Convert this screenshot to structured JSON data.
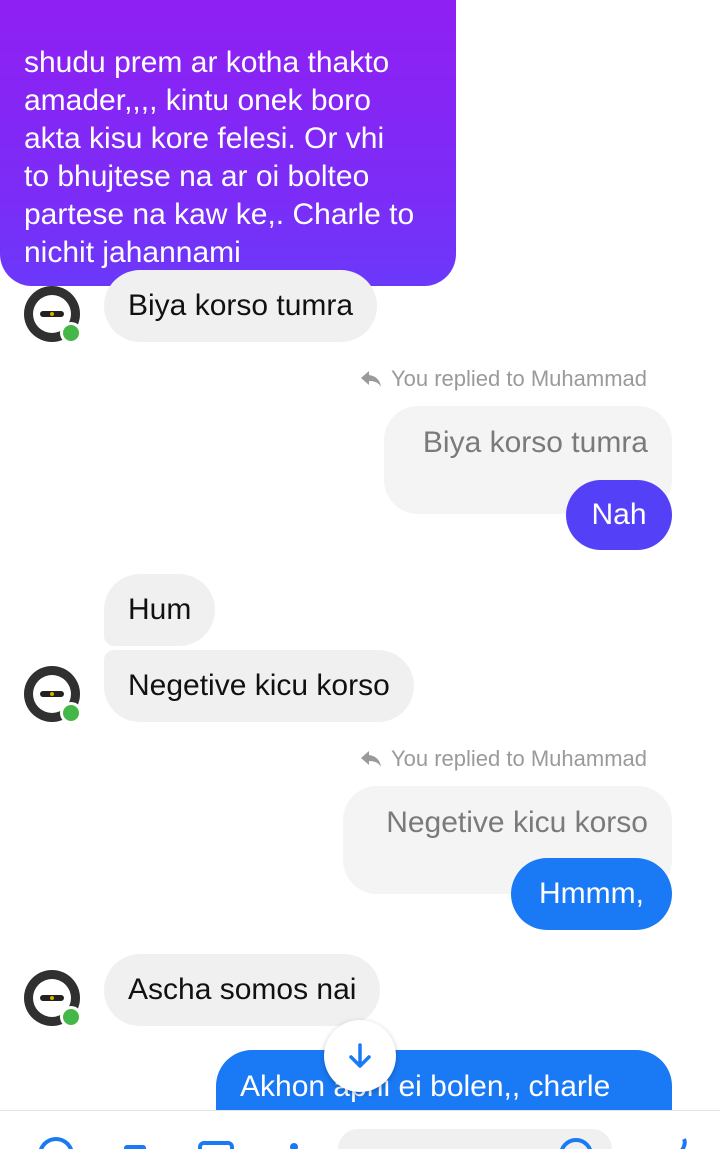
{
  "colors": {
    "incoming_bg": "#f0f0f0",
    "sent_purple": "#8e1cf4",
    "sent_indigo": "#5340f7",
    "sent_blue": "#1a7af5",
    "online_dot": "#44b748"
  },
  "messages": {
    "sent_top_lines": [
      "shudu prem ar kotha thakto",
      "amader,,,,  kintu onek boro",
      "akta kisu kore felesi.  Or vhi",
      "to bhujtese na ar oi bolteo",
      "partese na kaw ke,. Charle to",
      "nichit jahannami"
    ],
    "in_1": "Biya korso tumra",
    "reply_1_label": "You replied to Muhammad",
    "reply_1_quote": "Biya korso tumra",
    "sent_nah": "Nah",
    "in_hum": "Hum",
    "in_negetive": "Negetive kicu korso",
    "reply_2_label": "You replied to Muhammad",
    "reply_2_quote": "Negetive kicu korso",
    "sent_hmmm": "Hmmm,",
    "in_ascha": "Ascha somos nai",
    "sent_bottom": "Akhon apni ei bolen,, charle"
  },
  "icons": {
    "reply": "reply-arrow-icon",
    "scroll": "arrow-down-icon"
  }
}
